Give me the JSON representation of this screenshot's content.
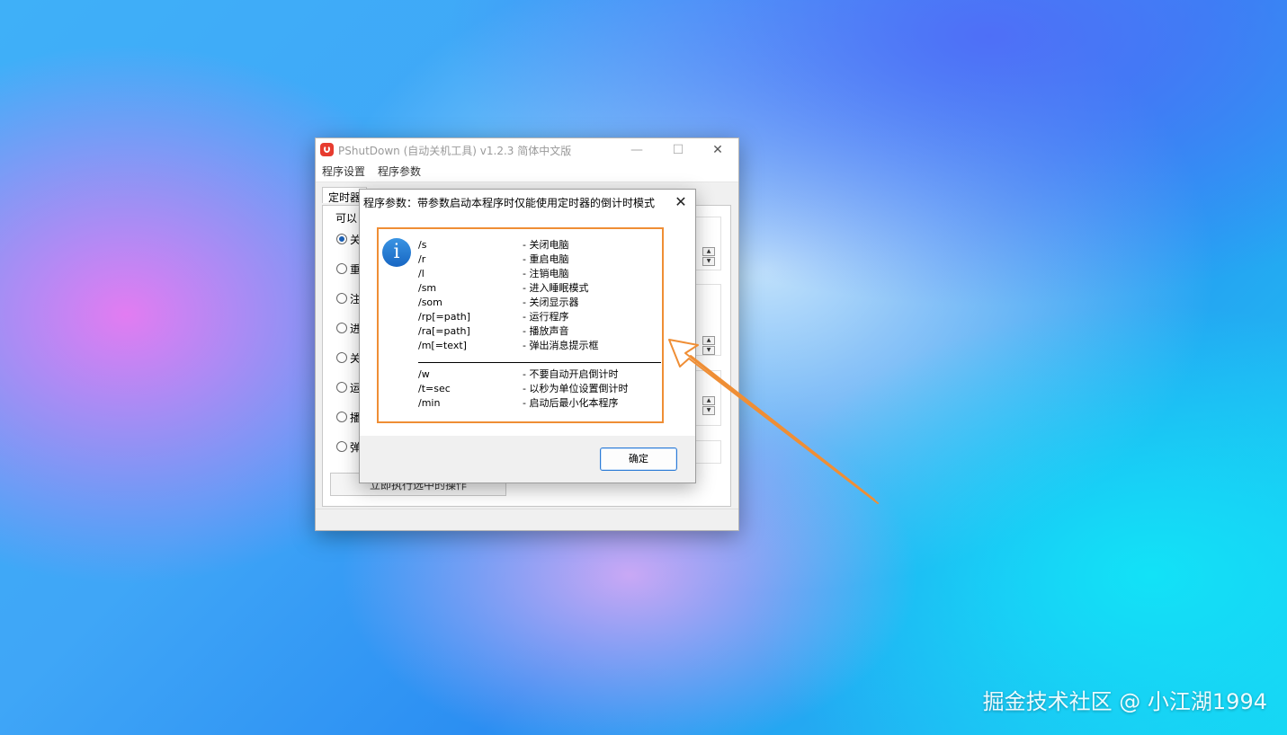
{
  "main_window": {
    "title": "PShutDown (自动关机工具) v1.2.3 简体中文版",
    "minimize_glyph": "—",
    "maximize_glyph": "☐",
    "close_glyph": "✕",
    "menu": [
      "程序设置",
      "程序参数"
    ],
    "tab_label": "定时器",
    "group_label": "可以",
    "radio_options": [
      {
        "label": "关",
        "checked": true
      },
      {
        "label": "重",
        "checked": false
      },
      {
        "label": "注",
        "checked": false
      },
      {
        "label": "进",
        "checked": false
      },
      {
        "label": "关",
        "checked": false
      },
      {
        "label": "运",
        "checked": false
      },
      {
        "label": "播",
        "checked": false
      },
      {
        "label": "弹",
        "checked": false
      }
    ],
    "execute_button": "立即执行选中的操作"
  },
  "dialog": {
    "title": "程序参数：带参数启动本程序时仅能使用定时器的倒计时模式",
    "close_glyph": "✕",
    "icon": "info-icon",
    "params_primary": [
      {
        "key": "/s",
        "desc": "- 关闭电脑"
      },
      {
        "key": "/r",
        "desc": "- 重启电脑"
      },
      {
        "key": "/l",
        "desc": "- 注销电脑"
      },
      {
        "key": "/sm",
        "desc": "- 进入睡眠模式"
      },
      {
        "key": "/som",
        "desc": "- 关闭显示器"
      },
      {
        "key": "/rp[=path]",
        "desc": "- 运行程序"
      },
      {
        "key": "/ra[=path]",
        "desc": "- 播放声音"
      },
      {
        "key": "/m[=text]",
        "desc": "- 弹出消息提示框"
      }
    ],
    "params_secondary": [
      {
        "key": "/w",
        "desc": "- 不要自动开启倒计时"
      },
      {
        "key": "/t=sec",
        "desc": "- 以秒为单位设置倒计时"
      },
      {
        "key": "/min",
        "desc": "- 启动后最小化本程序"
      }
    ],
    "ok_button": "确定"
  },
  "annotation": {
    "color": "#ef8e35"
  },
  "watermark": "掘金技术社区 @ 小江湖1994"
}
